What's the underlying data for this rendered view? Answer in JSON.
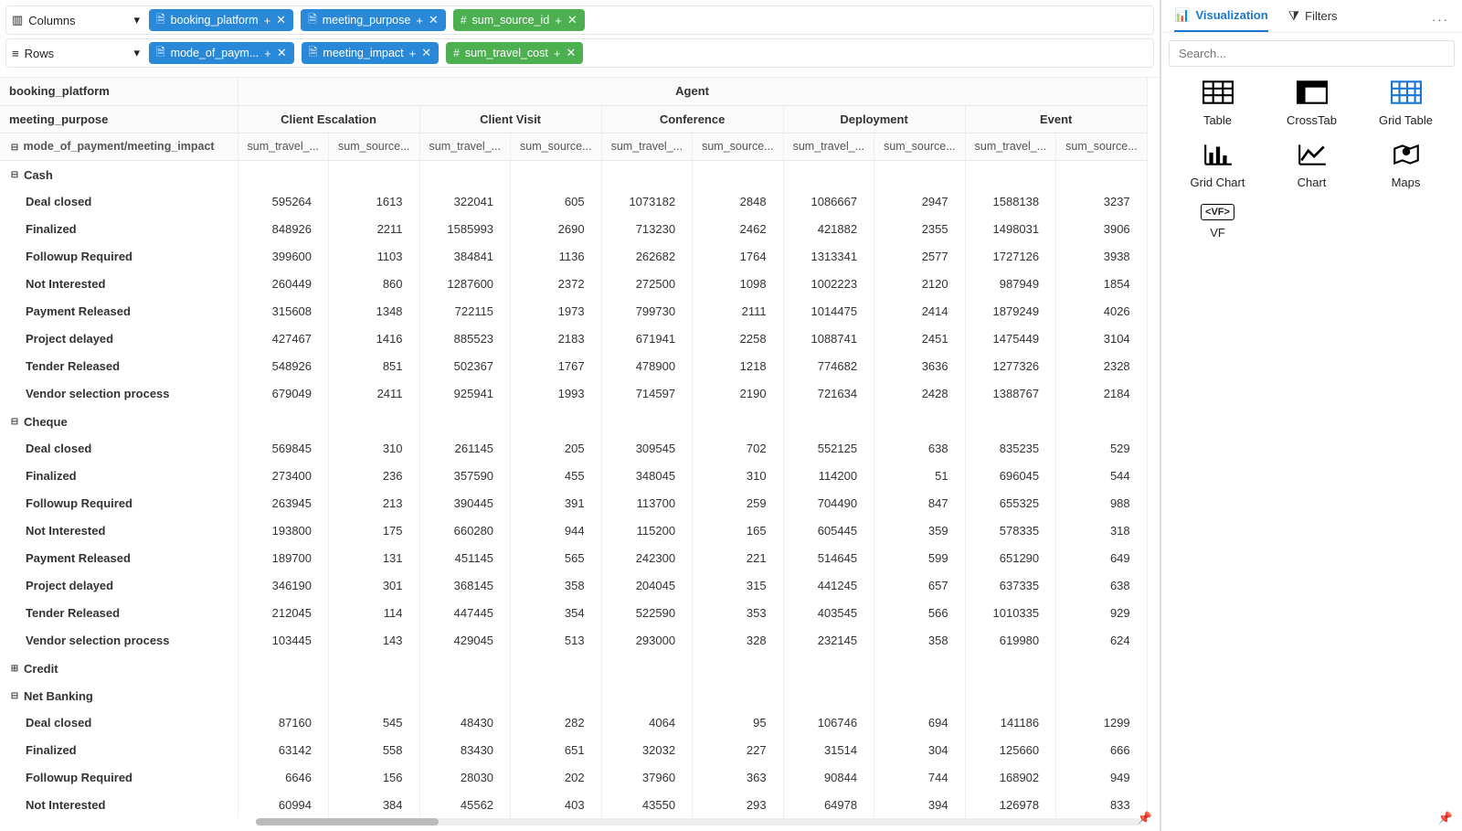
{
  "shelves": {
    "columns_label": "Columns",
    "rows_label": "Rows",
    "column_pills": [
      {
        "icon": "doc",
        "label": "booking_platform"
      },
      {
        "icon": "doc",
        "label": "meeting_purpose"
      },
      {
        "icon": "hash",
        "label": "sum_source_id",
        "measure": true
      }
    ],
    "row_pills": [
      {
        "icon": "doc",
        "label": "mode_of_paym..."
      },
      {
        "icon": "doc",
        "label": "meeting_impact"
      },
      {
        "icon": "hash",
        "label": "sum_travel_cost",
        "measure": true
      }
    ]
  },
  "headers": {
    "row_corner_1": "booking_platform",
    "row_corner_2": "meeting_purpose",
    "row_corner_3": "mode_of_payment/meeting_impact",
    "top_group": "Agent",
    "col_groups": [
      "Client Escalation",
      "Client Visit",
      "Conference",
      "Deployment",
      "Event"
    ],
    "measures": [
      "sum_travel_...",
      "sum_source..."
    ]
  },
  "rows": [
    {
      "type": "group",
      "label": "Cash",
      "expanded": true
    },
    {
      "type": "leaf",
      "label": "Deal closed",
      "vals": [
        595264,
        1613,
        322041,
        605,
        1073182,
        2848,
        1086667,
        2947,
        1588138,
        3237
      ]
    },
    {
      "type": "leaf",
      "label": "Finalized",
      "vals": [
        848926,
        2211,
        1585993,
        2690,
        713230,
        2462,
        421882,
        2355,
        1498031,
        3906
      ]
    },
    {
      "type": "leaf",
      "label": "Followup Required",
      "vals": [
        399600,
        1103,
        384841,
        1136,
        262682,
        1764,
        1313341,
        2577,
        1727126,
        3938
      ]
    },
    {
      "type": "leaf",
      "label": "Not Interested",
      "vals": [
        260449,
        860,
        1287600,
        2372,
        272500,
        1098,
        1002223,
        2120,
        987949,
        1854
      ]
    },
    {
      "type": "leaf",
      "label": "Payment Released",
      "vals": [
        315608,
        1348,
        722115,
        1973,
        799730,
        2111,
        1014475,
        2414,
        1879249,
        4026
      ]
    },
    {
      "type": "leaf",
      "label": "Project delayed",
      "vals": [
        427467,
        1416,
        885523,
        2183,
        671941,
        2258,
        1088741,
        2451,
        1475449,
        3104
      ]
    },
    {
      "type": "leaf",
      "label": "Tender Released",
      "vals": [
        548926,
        851,
        502367,
        1767,
        478900,
        1218,
        774682,
        3636,
        1277326,
        2328
      ]
    },
    {
      "type": "leaf",
      "label": "Vendor selection process",
      "vals": [
        679049,
        2411,
        925941,
        1993,
        714597,
        2190,
        721634,
        2428,
        1388767,
        2184
      ]
    },
    {
      "type": "group",
      "label": "Cheque",
      "expanded": true
    },
    {
      "type": "leaf",
      "label": "Deal closed",
      "vals": [
        569845,
        310,
        261145,
        205,
        309545,
        702,
        552125,
        638,
        835235,
        529
      ]
    },
    {
      "type": "leaf",
      "label": "Finalized",
      "vals": [
        273400,
        236,
        357590,
        455,
        348045,
        310,
        114200,
        51,
        696045,
        544
      ]
    },
    {
      "type": "leaf",
      "label": "Followup Required",
      "vals": [
        263945,
        213,
        390445,
        391,
        113700,
        259,
        704490,
        847,
        655325,
        988
      ]
    },
    {
      "type": "leaf",
      "label": "Not Interested",
      "vals": [
        193800,
        175,
        660280,
        944,
        115200,
        165,
        605445,
        359,
        578335,
        318
      ]
    },
    {
      "type": "leaf",
      "label": "Payment Released",
      "vals": [
        189700,
        131,
        451145,
        565,
        242300,
        221,
        514645,
        599,
        651290,
        649
      ]
    },
    {
      "type": "leaf",
      "label": "Project delayed",
      "vals": [
        346190,
        301,
        368145,
        358,
        204045,
        315,
        441245,
        657,
        637335,
        638
      ]
    },
    {
      "type": "leaf",
      "label": "Tender Released",
      "vals": [
        212045,
        114,
        447445,
        354,
        522590,
        353,
        403545,
        566,
        1010335,
        929
      ]
    },
    {
      "type": "leaf",
      "label": "Vendor selection process",
      "vals": [
        103445,
        143,
        429045,
        513,
        293000,
        328,
        232145,
        358,
        619980,
        624
      ]
    },
    {
      "type": "group",
      "label": "Credit",
      "expanded": false
    },
    {
      "type": "group",
      "label": "Net Banking",
      "expanded": true
    },
    {
      "type": "leaf",
      "label": "Deal closed",
      "vals": [
        87160,
        545,
        48430,
        282,
        4064,
        95,
        106746,
        694,
        141186,
        1299
      ]
    },
    {
      "type": "leaf",
      "label": "Finalized",
      "vals": [
        63142,
        558,
        83430,
        651,
        32032,
        227,
        31514,
        304,
        125660,
        666
      ]
    },
    {
      "type": "leaf",
      "label": "Followup Required",
      "vals": [
        6646,
        156,
        28030,
        202,
        37960,
        363,
        90844,
        744,
        168902,
        949
      ]
    },
    {
      "type": "leaf",
      "label": "Not Interested",
      "vals": [
        60994,
        384,
        45562,
        403,
        43550,
        293,
        64978,
        394,
        126978,
        833
      ]
    }
  ],
  "side": {
    "tab_viz": "Visualization",
    "tab_filters": "Filters",
    "search_placeholder": "Search...",
    "items": [
      {
        "key": "table",
        "label": "Table"
      },
      {
        "key": "crosstab",
        "label": "CrossTab"
      },
      {
        "key": "gridtable",
        "label": "Grid Table"
      },
      {
        "key": "gridchart",
        "label": "Grid Chart"
      },
      {
        "key": "chart",
        "label": "Chart"
      },
      {
        "key": "maps",
        "label": "Maps"
      },
      {
        "key": "vf",
        "label": "VF"
      }
    ]
  }
}
